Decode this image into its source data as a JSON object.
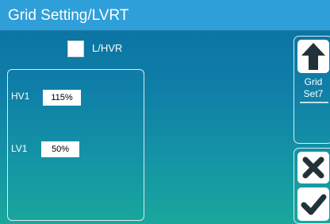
{
  "title": "Grid Setting/LVRT",
  "lhvr": {
    "label": "L/HVR",
    "checked": false
  },
  "fields": {
    "hv1": {
      "label": "HV1",
      "value": "115%"
    },
    "lv1": {
      "label": "LV1",
      "value": "50%"
    }
  },
  "side": {
    "up_icon": "arrow-up-icon",
    "grid_set_line1": "Grid",
    "grid_set_line2": "Set7",
    "cancel_icon": "close-icon",
    "confirm_icon": "check-icon"
  },
  "colors": {
    "title_bar": "#2f9fda",
    "icon": "#21323a",
    "background_top": "#0b6fa0",
    "background_bottom": "#1aa79c"
  }
}
